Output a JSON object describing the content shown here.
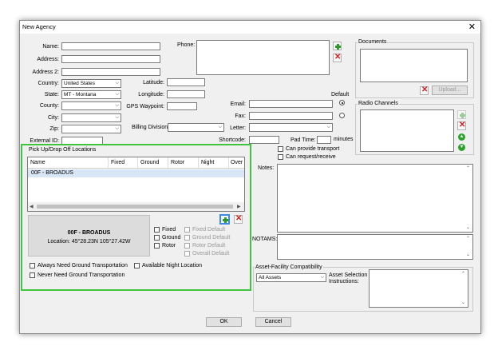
{
  "window": {
    "title": "New Agency",
    "close_glyph": "✕"
  },
  "fields": {
    "name": "Name:",
    "address": "Address:",
    "address2": "Address 2:",
    "country": "Country:",
    "country_value": "United States",
    "state": "State:",
    "state_value": "MT - Montana",
    "county": "County:",
    "city": "City:",
    "zip": "Zip:",
    "external_id": "External ID:",
    "phone": "Phone:",
    "latitude": "Latitude:",
    "longitude": "Longitude:",
    "gps_waypoint": "GPS Waypoint:",
    "billing_division": "Billing Division",
    "email": "Email:",
    "fax": "Fax:",
    "letter": "Letter:",
    "default": "Default",
    "shortcode": "Shortcode:",
    "pad_time": "Pad Time:",
    "minutes": "minutes",
    "can_provide_transport": "Can provide transport",
    "can_request_receive": "Can request/receive",
    "notes": "Notes:",
    "notams": "NOTAMS:"
  },
  "documents": {
    "label": "Documents",
    "upload": "Upload..."
  },
  "radio_channels": {
    "label": "Radio Channels"
  },
  "pickup": {
    "label": "Pick Up/Drop Off Locations",
    "columns": [
      "Name",
      "Fixed",
      "Ground",
      "Rotor",
      "Night",
      "Over"
    ],
    "rows": [
      {
        "name": "00F - BROADUS"
      }
    ],
    "detail_name": "00F - BROADUS",
    "detail_location": "Location: 45°28.23N 105°27.42W",
    "checks": [
      "Fixed",
      "Ground",
      "Rotor"
    ],
    "defaults": [
      "Fixed Default",
      "Ground Default",
      "Rotor Default",
      "Overall Default"
    ],
    "always_ground": "Always Need Ground Transportation",
    "never_ground": "Never Need Ground Transportation",
    "night_location": "Available Night Location"
  },
  "asset": {
    "label": "Asset-Facility Compatibility",
    "select_value": "All Assets",
    "instructions": "Asset Selection Instructions:"
  },
  "buttons": {
    "ok": "OK",
    "cancel": "Cancel"
  },
  "colors": {
    "highlight": "#3ec43e",
    "add": "#2c9a2c",
    "remove": "#d02020"
  }
}
